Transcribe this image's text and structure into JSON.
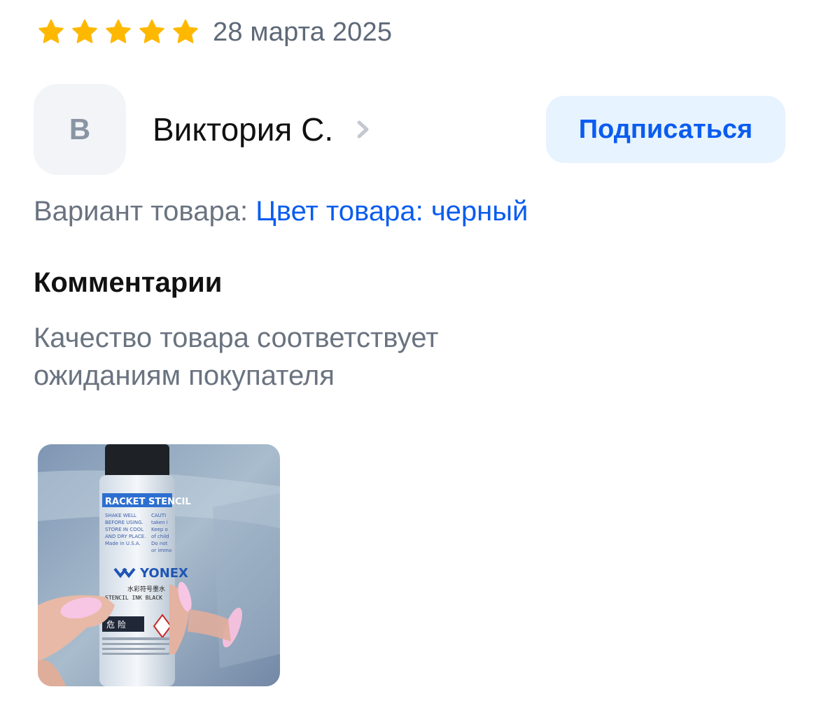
{
  "review": {
    "rating": 5,
    "rating_max": 5,
    "star_icon": "star-icon",
    "date": "28 марта 2025"
  },
  "author": {
    "initial": "В",
    "name": "Виктория С.",
    "chevron_icon": "chevron-right-icon"
  },
  "subscribe": {
    "label": "Подписаться"
  },
  "variant": {
    "label": "Вариант товара:",
    "value": "Цвет товара: черный"
  },
  "comments": {
    "title": "Комментарии",
    "text": "Качество товара соответствует ожиданиям покупателя"
  },
  "photo": {
    "label_title": "RACKET STENCIL",
    "label_lines_left": [
      "SHAKE WELL",
      "BEFORE USING.",
      "STORE IN COOL",
      "AND DRY PLACE.",
      "Made in U.S.A."
    ],
    "label_lines_right": [
      "CAUTI",
      "taken i",
      "Keep o",
      "of child",
      "Do not",
      "or immo"
    ],
    "brand": "YONEX",
    "cn_line": "水彩符号墨水",
    "ink_line": "STENCIL INK BLACK",
    "danger": "危 险"
  },
  "colors": {
    "star": "#ffb800",
    "accent": "#0a5cf0",
    "button_bg": "#e7f3ff",
    "muted_text": "#6a7380",
    "avatar_bg": "#f2f4f8"
  }
}
